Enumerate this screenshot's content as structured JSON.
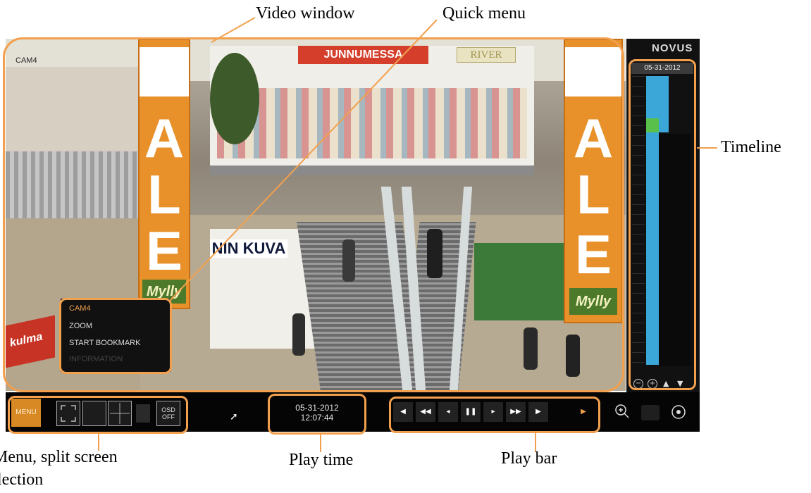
{
  "callouts": {
    "video_window": "Video window",
    "quick_menu": "Quick menu",
    "timeline": "Timeline",
    "menu_split": "Menu, split screen",
    "menu_split_line2": "lection",
    "play_time": "Play time",
    "play_bar": "Play bar"
  },
  "video": {
    "camera_label": "CAM4",
    "banner_letters": [
      "A",
      "L",
      "E"
    ],
    "banner_brand": "Mylly",
    "store_sign_1": "JUNNUMESSA",
    "store_sign_2": "RIVER",
    "store_sign_3": "NIN KUVA",
    "side_sign": "kulma"
  },
  "quick_menu": {
    "items": [
      "CAM4",
      "ZOOM",
      "START BOOKMARK",
      "INFORMATION"
    ],
    "active_color": "#f2a04e"
  },
  "timeline": {
    "logo": "NOVUS",
    "date": "05-31-2012",
    "controls": [
      "zoom-out-icon",
      "zoom-in-icon",
      "up-icon",
      "down-icon"
    ]
  },
  "bottombar": {
    "menu_label": "MENU",
    "osd_label_1": "OSD",
    "osd_label_2": "OFF",
    "play_date": "05-31-2012",
    "play_time": "12:07:44",
    "play_buttons": [
      "◀",
      "◀◀",
      "◂",
      "❚❚",
      "▸",
      "▶▶",
      "▶",
      "▶"
    ],
    "right_icons": [
      "zoom-icon",
      "camera-icon",
      "record-icon"
    ]
  },
  "colors": {
    "accent": "#f2a04e",
    "timeline_fill": "#3aa7d8",
    "timeline_motion": "#58c04b"
  }
}
